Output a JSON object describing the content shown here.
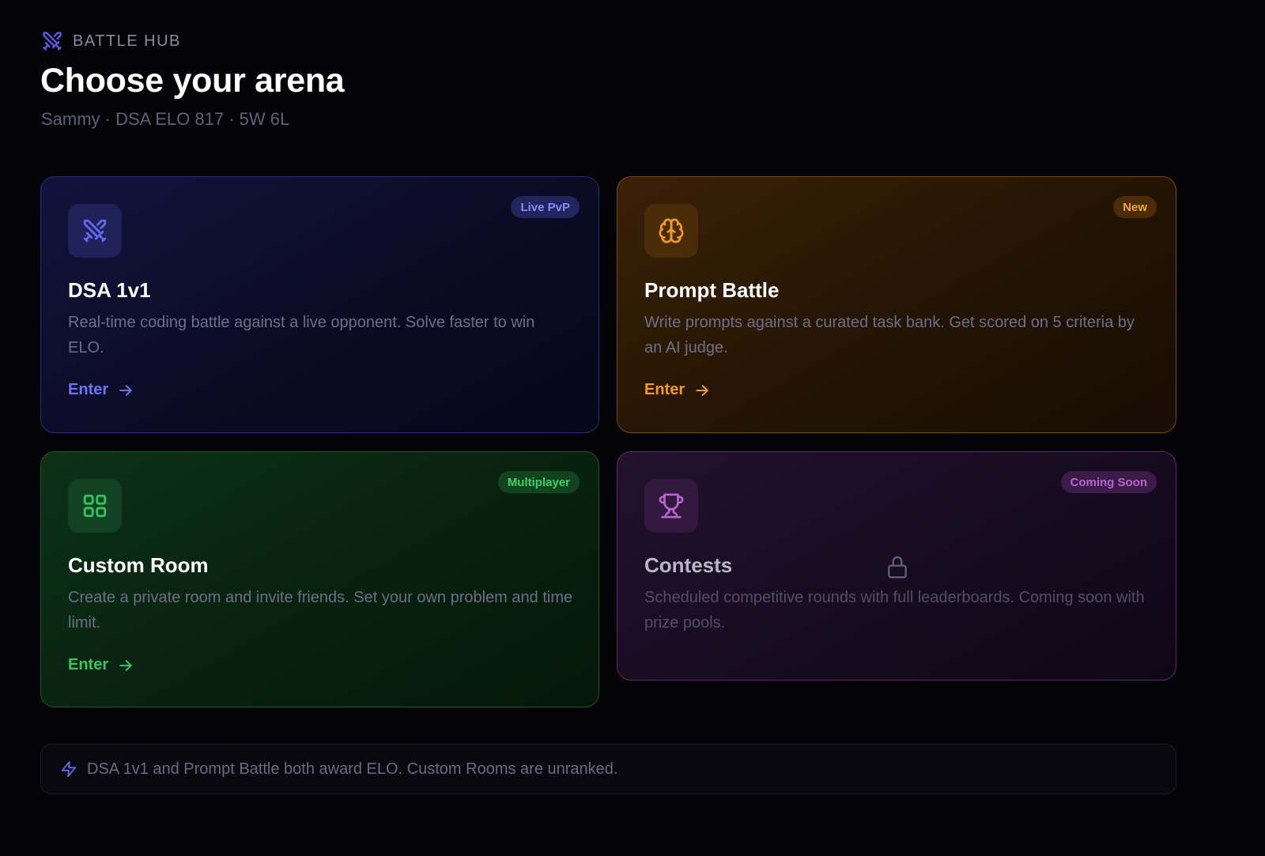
{
  "header": {
    "hub_label": "BATTLE HUB",
    "title": "Choose your arena",
    "subtitle": "Sammy · DSA ELO 817 · 5W 6L"
  },
  "cards": [
    {
      "id": "dsa-1v1",
      "badge": "Live PvP",
      "icon": "swords-icon",
      "title": "DSA 1v1",
      "description": "Real-time coding battle against a live opponent. Solve faster to win ELO.",
      "action": "Enter",
      "accent": "#6f72f2"
    },
    {
      "id": "prompt-battle",
      "badge": "New",
      "icon": "brain-icon",
      "title": "Prompt Battle",
      "description": "Write prompts against a curated task bank. Get scored on 5 criteria by an AI judge.",
      "action": "Enter",
      "accent": "#f29a23"
    },
    {
      "id": "custom-room",
      "badge": "Multiplayer",
      "icon": "grid-icon",
      "title": "Custom Room",
      "description": "Create a private room and invite friends. Set your own problem and time limit.",
      "action": "Enter",
      "accent": "#35c560"
    },
    {
      "id": "contests",
      "badge": "Coming Soon",
      "icon": "trophy-icon",
      "title": "Contests",
      "description": "Scheduled competitive rounds with full leaderboards. Coming soon with prize pools.",
      "locked_icon": "lock-icon",
      "accent": "#b864d0"
    }
  ],
  "footer": {
    "icon": "lightning-icon",
    "note": "DSA 1v1 and Prompt Battle both award ELO. Custom Rooms are unranked."
  }
}
